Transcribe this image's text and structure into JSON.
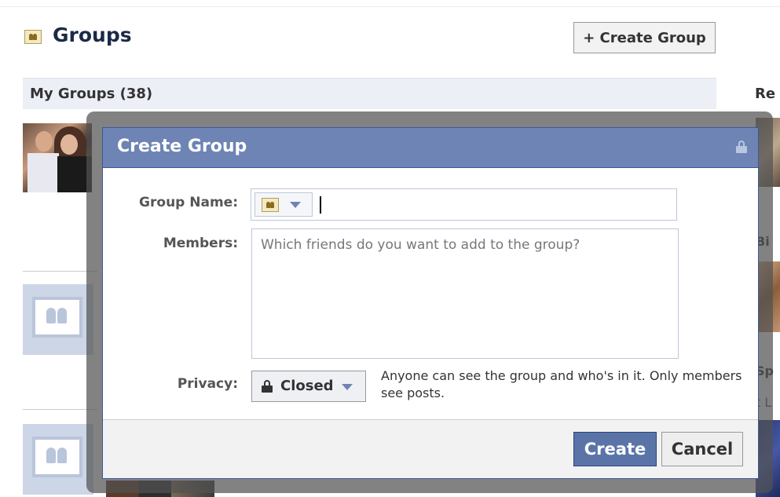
{
  "page": {
    "title": "Groups",
    "create_group_button": "+ Create Group",
    "my_groups_heading": "My Groups (38)",
    "right_column_labels": [
      "Re",
      "Bi",
      "Sp",
      "t L"
    ]
  },
  "dialog": {
    "title": "Create Group",
    "group_name_label": "Group Name:",
    "group_name_value": "",
    "members_label": "Members:",
    "members_placeholder": "Which friends do you want to add to the group?",
    "privacy_label": "Privacy:",
    "privacy_value": "Closed",
    "privacy_description": "Anyone can see the group and who's in it. Only members see posts.",
    "create_button": "Create",
    "cancel_button": "Cancel"
  },
  "icons": {
    "group_icon": "group-icon",
    "dropdown_arrow": "chevron-down-icon",
    "lock": "lock-icon"
  },
  "colors": {
    "header_blue": "#6d84b4",
    "primary_button": "#5b74a8",
    "title_text": "#1c2a47",
    "section_bar": "#eceff5"
  }
}
